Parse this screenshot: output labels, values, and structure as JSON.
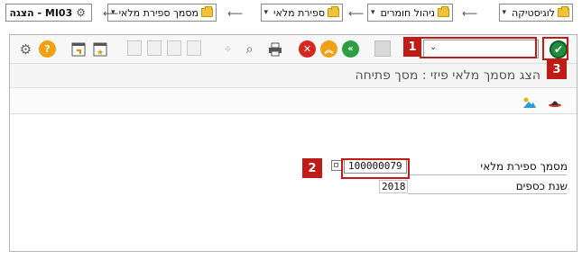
{
  "breadcrumb": {
    "items": [
      {
        "label": "לוגיסטיקה"
      },
      {
        "label": "ניהול חומרים"
      },
      {
        "label": "ספירת מלאי"
      },
      {
        "label": "מסמך ספירת מלאי"
      },
      {
        "label": "MI03 - הצגה"
      }
    ]
  },
  "toolbar": {
    "command_field_value": "",
    "icons": [
      "ok-icon",
      "command-dropdown-icon",
      "save-icon",
      "back-icon",
      "exit-icon",
      "cancel-icon",
      "print-icon",
      "find-icon",
      "find-next-icon",
      "first-page-icon",
      "previous-page-icon",
      "next-page-icon",
      "last-page-icon",
      "new-session-icon",
      "shortcut-icon",
      "help-icon",
      "settings-icon"
    ]
  },
  "screen": {
    "title": "הצג מסמך מלאי פיזי  : מסך פתיחה"
  },
  "app_toolbar": {
    "icons": [
      "hat-icon",
      "image-icon"
    ]
  },
  "form": {
    "document_label": "מסמך ספירת מלאי",
    "document_value": "100000079",
    "fiscal_year_label": "שנת כספים",
    "fiscal_year_value": "2018"
  },
  "callouts": {
    "one": "1",
    "two": "2",
    "three": "3"
  },
  "colors": {
    "callout": "#c11b17",
    "ok_green": "#1f8f3e",
    "cancel_red": "#d7261e",
    "back_green": "#2e9e43",
    "exit_orange": "#f0a012",
    "help_orange": "#f0a012"
  }
}
